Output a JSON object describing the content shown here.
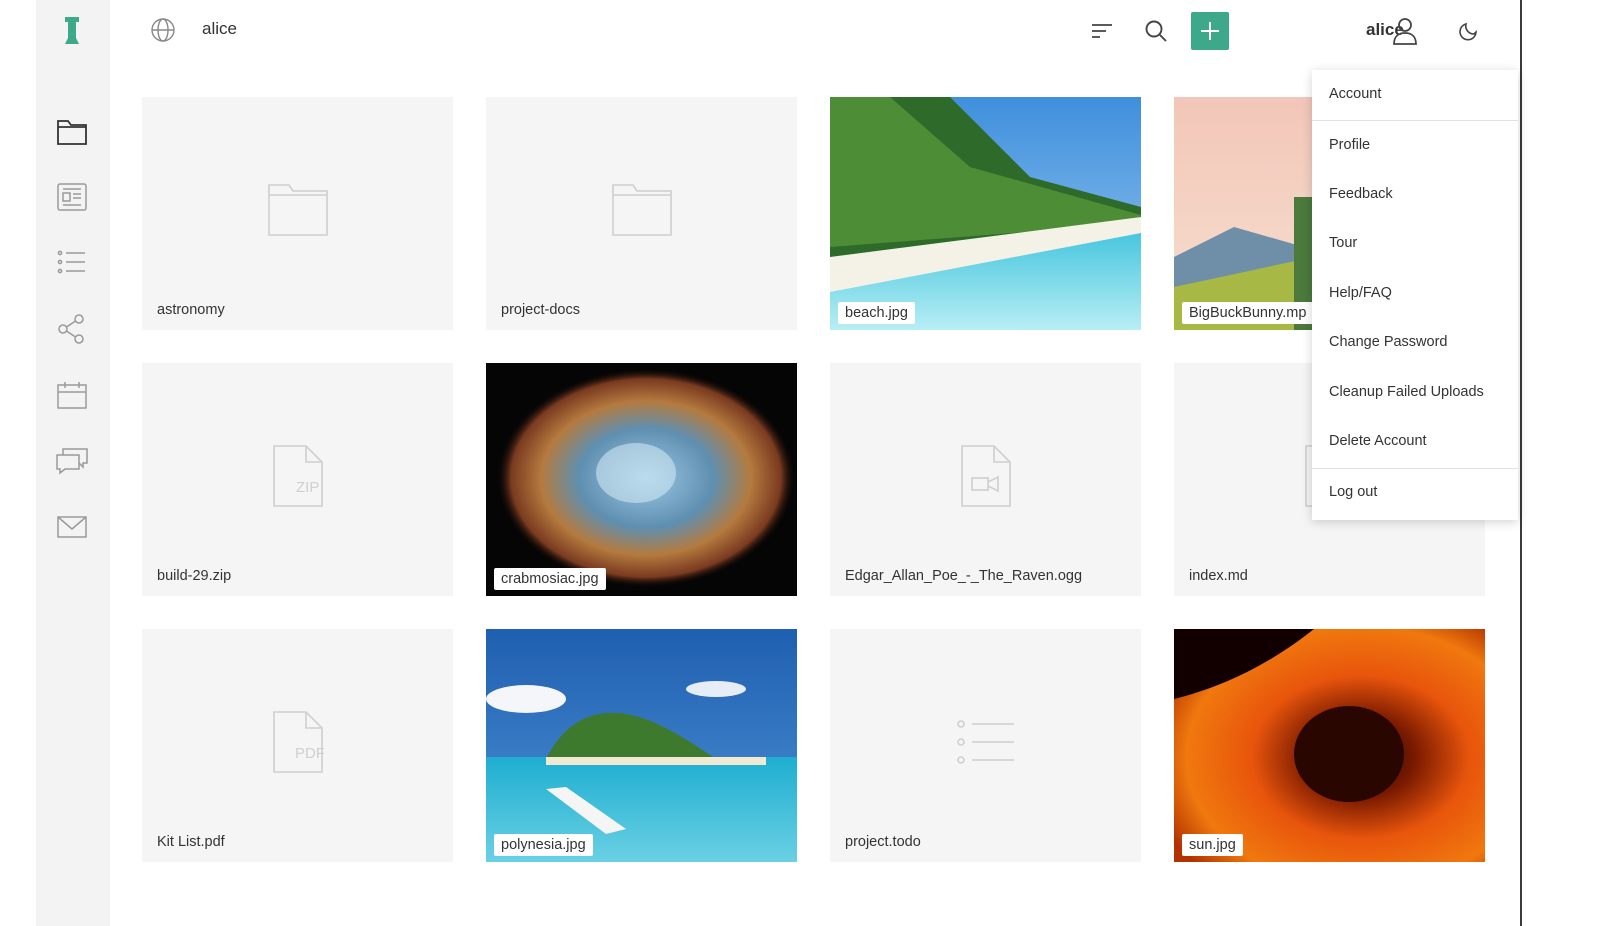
{
  "app": {
    "accent_color": "#3ea88a",
    "logo_icon": "chess-rook-logo-icon"
  },
  "sidebar": {
    "items": [
      {
        "name": "files",
        "icon": "folder-icon",
        "active": true
      },
      {
        "name": "documents",
        "icon": "document-icon"
      },
      {
        "name": "tasks",
        "icon": "list-icon"
      },
      {
        "name": "shared",
        "icon": "share-icon"
      },
      {
        "name": "calendar",
        "icon": "calendar-icon"
      },
      {
        "name": "chat",
        "icon": "chat-icon"
      },
      {
        "name": "email",
        "icon": "mail-icon"
      }
    ]
  },
  "header": {
    "path": "alice",
    "username": "alice",
    "buttons": [
      "sort-icon",
      "search-icon",
      "plus-icon",
      "user-icon",
      "moon-icon"
    ]
  },
  "files": [
    {
      "name": "astronomy",
      "kind": "folder"
    },
    {
      "name": "project-docs",
      "kind": "folder"
    },
    {
      "name": "beach.jpg",
      "kind": "image"
    },
    {
      "name": "BigBuckBunny.mp",
      "kind": "video"
    },
    {
      "name": "build-29.zip",
      "kind": "zip",
      "icon_text": "ZIP"
    },
    {
      "name": "crabmosiac.jpg",
      "kind": "image"
    },
    {
      "name": "Edgar_Allan_Poe_-_The_Raven.ogg",
      "kind": "audio"
    },
    {
      "name": "index.md",
      "kind": "text"
    },
    {
      "name": "Kit List.pdf",
      "kind": "pdf",
      "icon_text": "PDF"
    },
    {
      "name": "polynesia.jpg",
      "kind": "image"
    },
    {
      "name": "project.todo",
      "kind": "todo"
    },
    {
      "name": "sun.jpg",
      "kind": "image"
    }
  ],
  "account_menu": {
    "items": [
      "Account",
      "Profile",
      "Feedback",
      "Tour",
      "Help/FAQ",
      "Change Password",
      "Cleanup Failed Uploads",
      "Delete Account",
      "Log out"
    ]
  }
}
